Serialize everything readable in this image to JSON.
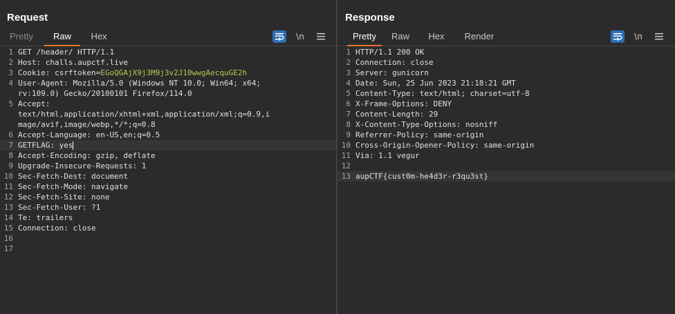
{
  "request": {
    "title": "Request",
    "tabs": [
      {
        "label": "Pretty"
      },
      {
        "label": "Raw"
      },
      {
        "label": "Hex"
      }
    ],
    "active_tab": "Raw",
    "newline_icon": "\\n",
    "lines": [
      "GET /header/ HTTP/1.1",
      "Host: challs.aupctf.live",
      "Cookie: csrftoken=",
      "User-Agent: Mozilla/5.0 (Windows NT 10.0; Win64; x64;",
      "rv:109.0) Gecko/20100101 Firefox/114.0",
      "Accept:",
      "text/html,application/xhtml+xml,application/xml;q=0.9,i",
      "mage/avif,image/webp,*/*;q=0.8",
      "Accept-Language: en-US,en;q=0.5",
      "GETFLAG: yes",
      "Accept-Encoding: gzip, deflate",
      "Upgrade-Insecure-Requests: 1",
      "Sec-Fetch-Dest: document",
      "Sec-Fetch-Mode: navigate",
      "Sec-Fetch-Site: none",
      "Sec-Fetch-User: ?1",
      "Te: trailers",
      "Connection: close",
      "",
      ""
    ],
    "cookie_value": "EGoQGAjX9j3M9j3v2J10wwgAecquGE2h",
    "line_numbers": [
      "1",
      "2",
      "3",
      "4",
      "",
      "5",
      "",
      "",
      "6",
      "7",
      "8",
      "9",
      "10",
      "11",
      "12",
      "13",
      "14",
      "15",
      "16",
      "17"
    ]
  },
  "response": {
    "title": "Response",
    "tabs": [
      {
        "label": "Pretty"
      },
      {
        "label": "Raw"
      },
      {
        "label": "Hex"
      },
      {
        "label": "Render"
      }
    ],
    "active_tab": "Pretty",
    "newline_icon": "\\n",
    "lines": [
      "HTTP/1.1 200 OK",
      "Connection: close",
      "Server: gunicorn",
      "Date: Sun, 25 Jun 2023 21:18:21 GMT",
      "Content-Type: text/html; charset=utf-8",
      "X-Frame-Options: DENY",
      "Content-Length: 29",
      "X-Content-Type-Options: nosniff",
      "Referrer-Policy: same-origin",
      "Cross-Origin-Opener-Policy: same-origin",
      "Via: 1.1 vegur",
      "",
      "aupCTF{cust0m-he4d3r-r3qu3st}"
    ],
    "line_numbers": [
      "1",
      "2",
      "3",
      "4",
      "5",
      "6",
      "7",
      "8",
      "9",
      "10",
      "11",
      "12",
      "13"
    ]
  },
  "colors": {
    "accent_tab_underline": "#e8762d",
    "selected_button": "#2f6fb5",
    "cookie_value": "#b7c94f"
  },
  "icons": {
    "wrap": "wrap-lines-icon",
    "menu": "hamburger-menu-icon",
    "layout": [
      "side-by-side-layout-icon",
      "top-bottom-layout-icon",
      "single-panel-layout-icon"
    ]
  }
}
